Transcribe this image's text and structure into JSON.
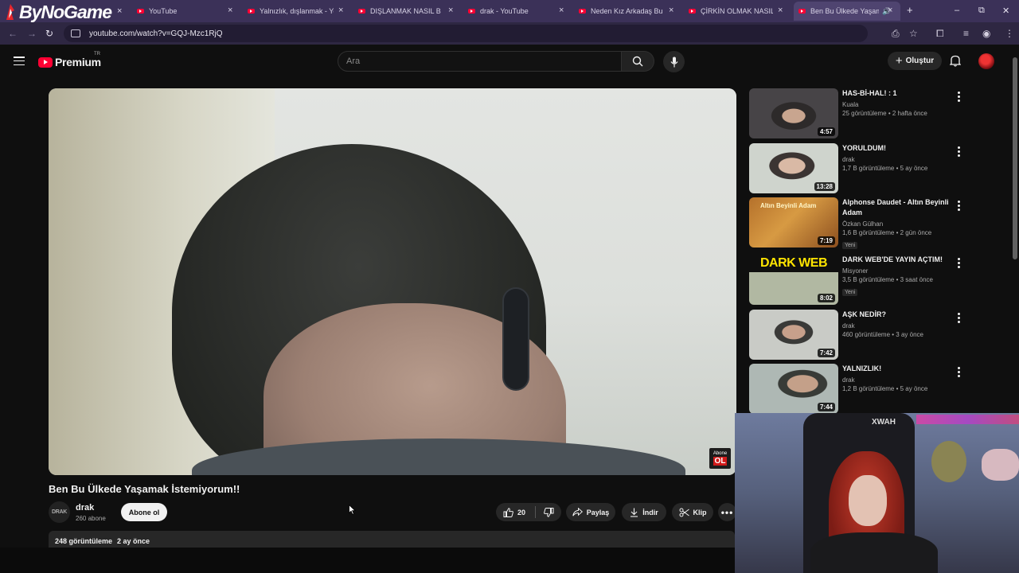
{
  "overlay": {
    "brand": "ByNoGame",
    "close_glyph": "×"
  },
  "browser": {
    "tabs": [
      {
        "title": "YouTube"
      },
      {
        "title": "Yalnızlık, dışlanmak - You"
      },
      {
        "title": "DIŞLANMAK NASIL BİRŞE"
      },
      {
        "title": "drak - YouTube"
      },
      {
        "title": "Neden Kız Arkadaş Bulam"
      },
      {
        "title": "ÇİRKİN OLMAK NASIL Bİ"
      },
      {
        "title": "Ben Bu Ülkede Yaşam"
      }
    ],
    "close_glyph": "×",
    "new_tab_glyph": "+",
    "window_controls": {
      "minimize": "–",
      "restore": "⧉",
      "close": "✕"
    },
    "nav": {
      "back": "←",
      "forward": "→",
      "reload": "↻"
    },
    "url": "youtube.com/watch?v=GQJ-Mzc1RjQ",
    "address_icons": [
      "install-icon",
      "star-icon",
      "extensions-icon",
      "media-icon",
      "profile-icon",
      "menu-icon"
    ]
  },
  "youtube": {
    "logo": {
      "word": "Premium",
      "country": "TR"
    },
    "search": {
      "placeholder": "Ara",
      "value": ""
    },
    "create_label": "Oluştur"
  },
  "video": {
    "title": "Ben Bu Ülkede Yaşamak İstemiyorum!!",
    "badge": {
      "line1": "Abone",
      "line2": "OL"
    },
    "channel": {
      "avatar_text": "DRAK",
      "name": "drak",
      "subscribers": "260 abone"
    },
    "subscribe_label": "Abone ol",
    "likes": "20",
    "share_label": "Paylaş",
    "download_label": "İndir",
    "clip_label": "Klip",
    "views": "248 görüntüleme",
    "age": "2 ay önce"
  },
  "recommendations": [
    {
      "title_lines": [
        "HAS-Bİ-HAL! : 1"
      ],
      "channel": "Kuala",
      "views": "25 görüntüleme",
      "age": "2 hafta önce",
      "duration": "4:57",
      "badge": ""
    },
    {
      "title_lines": [
        "YORULDUM!"
      ],
      "channel": "drak",
      "views": "1,7 B görüntüleme",
      "age": "5 ay önce",
      "duration": "13:28",
      "badge": ""
    },
    {
      "title_lines": [
        "Alphonse Daudet - Altın Beyinli",
        "Adam"
      ],
      "channel": "Özkan Gülhan",
      "views": "1,6 B görüntüleme",
      "age": "2 gün önce",
      "duration": "7:19",
      "badge": "Yeni",
      "thumb_text": "Altın Beyinli Adam"
    },
    {
      "title_lines": [
        "DARK WEB'DE YAYIN AÇTIM!"
      ],
      "channel": "Misyoner",
      "views": "3,5 B görüntüleme",
      "age": "3 saat önce",
      "duration": "8:02",
      "badge": "Yeni",
      "thumb_text": "DARK WEB"
    },
    {
      "title_lines": [
        "AŞK NEDİR?"
      ],
      "channel": "drak",
      "views": "460 görüntüleme",
      "age": "3 ay önce",
      "duration": "7:42",
      "badge": ""
    },
    {
      "title_lines": [
        "YALNIZLIK!"
      ],
      "channel": "drak",
      "views": "1,2 B görüntüleme",
      "age": "5 ay önce",
      "duration": "7:44",
      "badge": ""
    }
  ],
  "webcam": {
    "chair_logo": "XWAH"
  },
  "colors": {
    "tabstrip": "#3b3158",
    "addressbar": "#2e2742",
    "yt_bg": "#0f0f0f",
    "yt_red": "#ff0033",
    "pill": "#272727"
  }
}
